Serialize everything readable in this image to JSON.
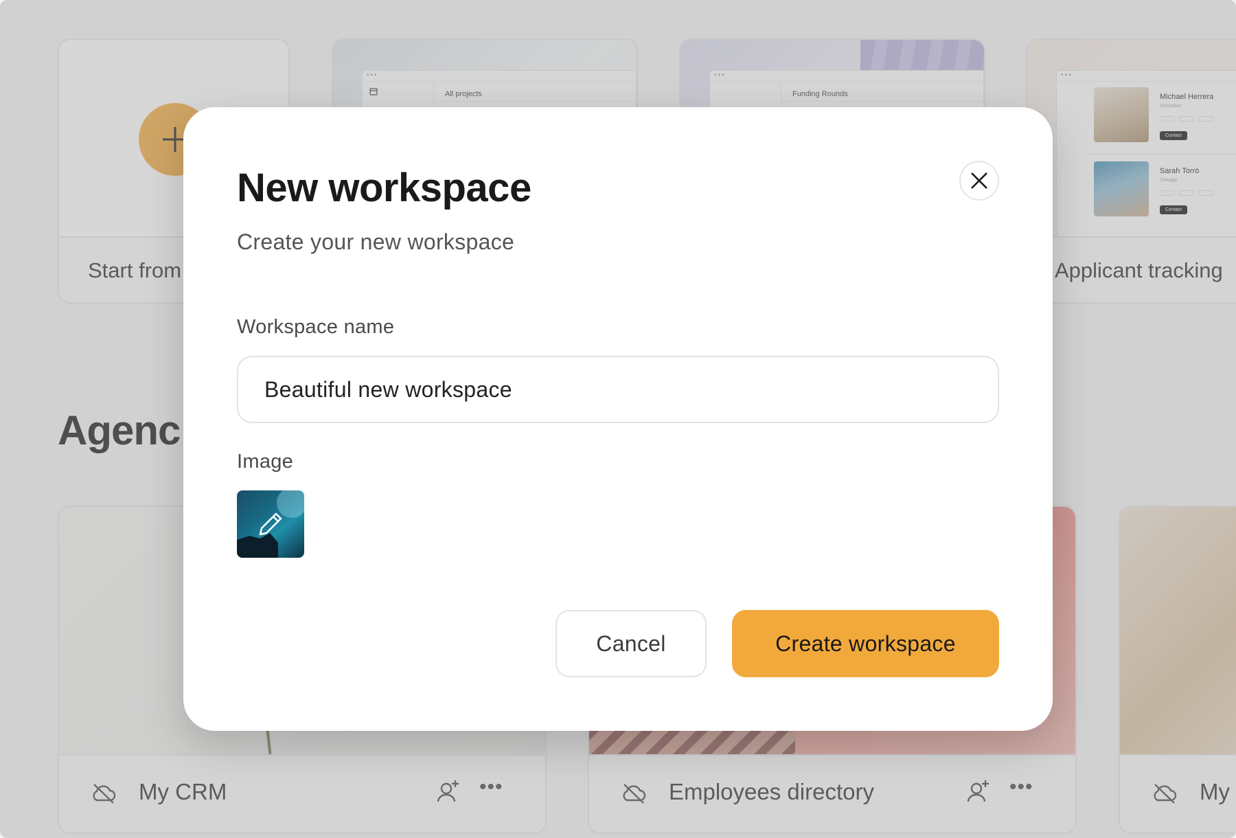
{
  "templates": {
    "start_label": "Start from",
    "projects_title": "All projects",
    "funding_title": "Funding Rounds",
    "applicant_label": "Applicant tracking",
    "applicants": [
      {
        "name": "Michael Herrera",
        "city": "Columbus",
        "contact": "Contact"
      },
      {
        "name": "Sarah Torró",
        "city": "Chicago",
        "contact": "Contact"
      }
    ]
  },
  "section": {
    "title": "Agenc"
  },
  "workspaces": [
    {
      "name": "My CRM"
    },
    {
      "name": "Employees directory"
    },
    {
      "name": "My"
    }
  ],
  "modal": {
    "title": "New workspace",
    "subtitle": "Create your new workspace",
    "name_label": "Workspace name",
    "name_value": "Beautiful new workspace",
    "image_label": "Image",
    "cancel_label": "Cancel",
    "create_label": "Create workspace"
  },
  "colors": {
    "accent": "#f2a93b",
    "overlay": "rgba(160,160,160,0.42)"
  },
  "icons": [
    "plus-icon",
    "close-icon",
    "pencil-icon",
    "cloud-off-icon",
    "user-plus-icon",
    "more-icon"
  ]
}
